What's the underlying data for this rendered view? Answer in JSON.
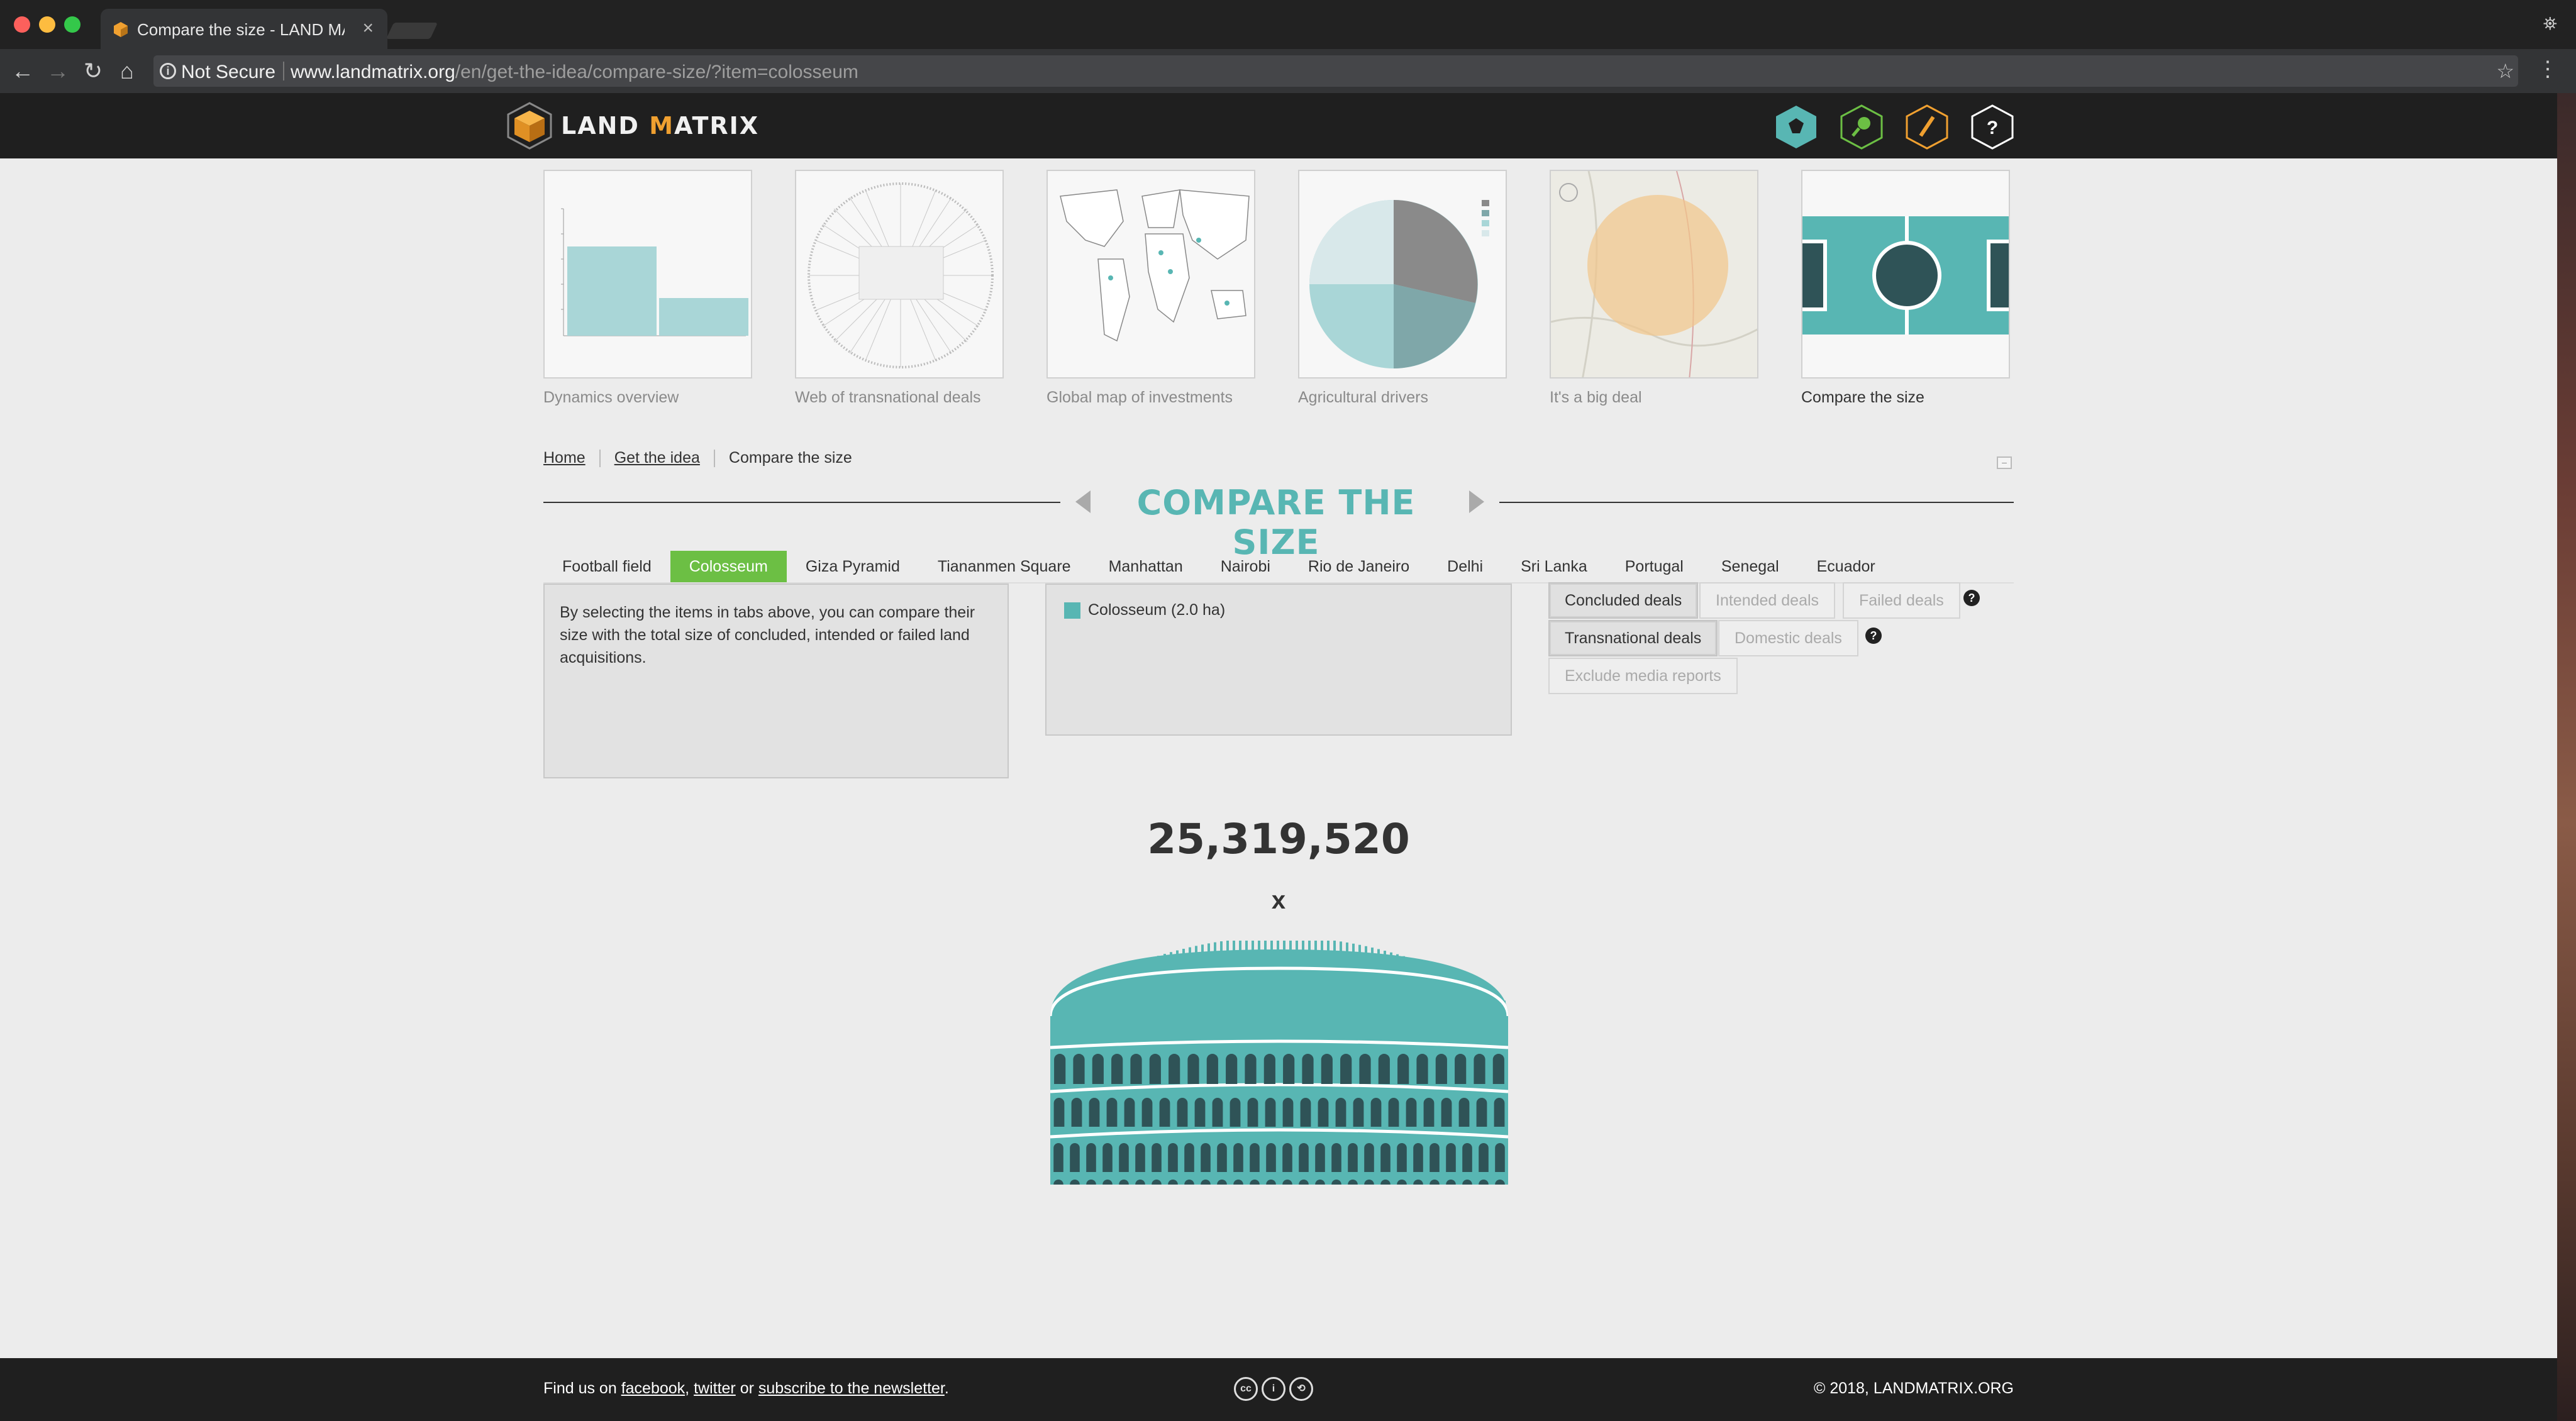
{
  "browser": {
    "tab_title": "Compare the size - LAND MATRIX",
    "security_label": "Not Secure",
    "url_host": "www.landmatrix.org",
    "url_path": "/en/get-the-idea/compare-size/?item=colosseum"
  },
  "header": {
    "logo_left": "LAND ",
    "logo_m": "M",
    "logo_right": "ATRIX",
    "icons": [
      "map-icon",
      "search-icon",
      "pencil-icon",
      "help-icon"
    ],
    "icon_colors": {
      "map": "#58b6b3",
      "search": "#6cbf44",
      "pencil": "#f0a030",
      "help": "#ffffff"
    }
  },
  "thumbnails": [
    {
      "label": "Dynamics overview"
    },
    {
      "label": "Web of transnational deals"
    },
    {
      "label": "Global map of investments"
    },
    {
      "label": "Agricultural drivers"
    },
    {
      "label": "It's a big deal"
    },
    {
      "label": "Compare the size"
    }
  ],
  "breadcrumb": {
    "home": "Home",
    "get_idea": "Get the idea",
    "current": "Compare the size"
  },
  "page_title": "COMPARE THE SIZE",
  "items": [
    {
      "label": "Football field"
    },
    {
      "label": "Colosseum",
      "active": true
    },
    {
      "label": "Giza Pyramid"
    },
    {
      "label": "Tiananmen Square"
    },
    {
      "label": "Manhattan"
    },
    {
      "label": "Nairobi"
    },
    {
      "label": "Rio de Janeiro"
    },
    {
      "label": "Delhi"
    },
    {
      "label": "Sri Lanka"
    },
    {
      "label": "Portugal"
    },
    {
      "label": "Senegal"
    },
    {
      "label": "Ecuador"
    }
  ],
  "info_text": "By selecting the items in tabs above, you can compare their size with the total size of concluded, intended or failed land acquisitions.",
  "legend": {
    "label": "Colosseum (2.0 ha)",
    "color": "#58b6b3"
  },
  "filters": {
    "concluded": "Concluded deals",
    "intended": "Intended deals",
    "failed": "Failed deals",
    "transnational": "Transnational deals",
    "domestic": "Domestic deals",
    "exclude_media": "Exclude media reports",
    "help": "?"
  },
  "result": {
    "count": "25,319,520",
    "times": "x"
  },
  "footer": {
    "find_us": "Find us on ",
    "facebook": "facebook",
    "comma": ", ",
    "twitter": "twitter",
    "or": " or ",
    "newsletter": "subscribe to the newsletter",
    "period": ".",
    "copyright": "© 2018, LANDMATRIX.ORG",
    "license_icons": [
      "cc-icon",
      "by-icon",
      "sa-icon"
    ]
  },
  "colors": {
    "accent": "#58b6b3",
    "active_tab": "#6cbf44",
    "header_bg": "#1f1f1f"
  }
}
